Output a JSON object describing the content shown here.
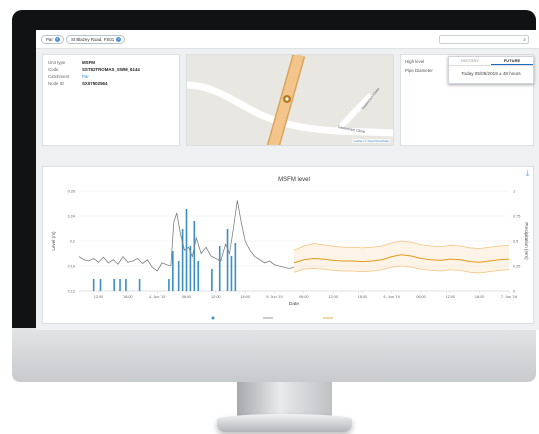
{
  "topbar": {
    "chip_1": "Par",
    "chip_2": "St Blazey Road, FS01",
    "search_placeholder": ""
  },
  "site": {
    "fields": [
      {
        "key": "Unit type",
        "value": "MSFM"
      },
      {
        "key": "Code",
        "value": "SST82TROMAS_SWM_6144"
      },
      {
        "key": "Catchment",
        "value": "Par"
      },
      {
        "key": "Node ID",
        "value": "SX07502564"
      }
    ]
  },
  "map": {
    "street_1": "Tredenham Close",
    "street_2": "Tredenham Close",
    "attribution": "Leaflet | © OpenStreetMap"
  },
  "meta": {
    "high_level_label": "High level",
    "pipe_diameter_label": "Pipe Diameter",
    "tabs": [
      "HISTORY",
      "FUTURE"
    ],
    "active_tab": "FUTURE",
    "forecast_time": "Today 05/05/2019 ± 48 hours"
  },
  "colors": {
    "observed": "#7f7f7f",
    "forecast_median": "#e39a1a",
    "forecast_band": "#f2c27a",
    "rain": "#3b8fc2",
    "link": "#3a8fd8"
  },
  "chart_data": {
    "type": "line",
    "title": "MSFM level",
    "xlabel": "Date",
    "ylabel": "Level (m)",
    "y2label": "Precipitation (mm)",
    "ylim": [
      0.12,
      0.28
    ],
    "y2lim": [
      0,
      1
    ],
    "yticks": [
      "0.28",
      "0.24",
      "0.2",
      "0.16",
      "0.12"
    ],
    "y2ticks": [
      "1",
      "0.75",
      "0.5",
      "0.25",
      "0"
    ],
    "xlim": [
      0,
      44
    ],
    "xticks": [
      {
        "x": 2,
        "label": "12:00"
      },
      {
        "x": 5,
        "label": "18:00"
      },
      {
        "x": 8,
        "label": "4. Jun '19"
      },
      {
        "x": 11,
        "label": "06:00"
      },
      {
        "x": 14,
        "label": "12:00"
      },
      {
        "x": 17,
        "label": "18:00"
      },
      {
        "x": 20,
        "label": "5. Jun '19"
      },
      {
        "x": 23,
        "label": "06:00"
      },
      {
        "x": 26,
        "label": "12:00"
      },
      {
        "x": 29,
        "label": "18:00"
      },
      {
        "x": 32,
        "label": "6. Jun '19"
      },
      {
        "x": 35,
        "label": "06:00"
      },
      {
        "x": 38,
        "label": "12:00"
      },
      {
        "x": 41,
        "label": "18:00"
      },
      {
        "x": 44,
        "label": "7. Jun '19"
      }
    ],
    "series": [
      {
        "kind": "observed",
        "x": [
          0,
          0.5,
          1,
          1.5,
          2,
          2.5,
          3,
          3.5,
          4,
          4.5,
          5,
          5.5,
          6,
          6.5,
          7,
          7.5,
          8,
          8.5,
          9,
          9.4,
          9.7,
          10,
          10.4,
          10.8,
          11.2,
          11.6,
          12,
          12.5,
          13,
          13.5,
          14,
          14.5,
          15,
          15.4,
          15.8,
          16.2,
          16.6,
          17,
          17.5,
          18,
          18.5,
          19,
          19.5,
          20,
          20.5,
          21,
          21.5,
          22
        ],
        "y": [
          0.175,
          0.17,
          0.168,
          0.172,
          0.166,
          0.174,
          0.165,
          0.17,
          0.163,
          0.175,
          0.166,
          0.168,
          0.172,
          0.164,
          0.17,
          0.158,
          0.152,
          0.165,
          0.162,
          0.16,
          0.23,
          0.245,
          0.21,
          0.185,
          0.19,
          0.175,
          0.205,
          0.18,
          0.19,
          0.176,
          0.172,
          0.168,
          0.195,
          0.18,
          0.22,
          0.265,
          0.23,
          0.2,
          0.185,
          0.175,
          0.17,
          0.165,
          0.168,
          0.162,
          0.16,
          0.158,
          0.156,
          0.158
        ]
      },
      {
        "kind": "forecast",
        "x": [
          22,
          23,
          24,
          25,
          26,
          27,
          28,
          29,
          30,
          31,
          32,
          33,
          34,
          35,
          36,
          37,
          38,
          39,
          40,
          41,
          42,
          43,
          44
        ],
        "median": [
          0.165,
          0.17,
          0.172,
          0.171,
          0.169,
          0.168,
          0.168,
          0.167,
          0.168,
          0.17,
          0.175,
          0.178,
          0.176,
          0.172,
          0.17,
          0.169,
          0.171,
          0.17,
          0.167,
          0.166,
          0.168,
          0.17,
          0.171
        ],
        "upper": [
          0.185,
          0.192,
          0.196,
          0.194,
          0.192,
          0.19,
          0.19,
          0.189,
          0.19,
          0.192,
          0.197,
          0.2,
          0.198,
          0.194,
          0.192,
          0.191,
          0.193,
          0.192,
          0.189,
          0.188,
          0.19,
          0.192,
          0.193
        ],
        "lower": [
          0.15,
          0.155,
          0.156,
          0.155,
          0.153,
          0.152,
          0.152,
          0.151,
          0.152,
          0.154,
          0.158,
          0.16,
          0.158,
          0.155,
          0.153,
          0.152,
          0.154,
          0.153,
          0.15,
          0.149,
          0.151,
          0.153,
          0.154
        ]
      }
    ],
    "precipitation": {
      "x": [
        1.5,
        2.2,
        3.6,
        4.2,
        4.8,
        6.2,
        9.2,
        9.6,
        10.2,
        10.6,
        11.0,
        11.4,
        11.8,
        12.2,
        13.6,
        14.4,
        15.2,
        15.6,
        16.0
      ],
      "values": [
        0.12,
        0.12,
        0.12,
        0.12,
        0.12,
        0.12,
        0.12,
        0.4,
        0.3,
        0.62,
        0.82,
        0.45,
        0.7,
        0.3,
        0.22,
        0.45,
        0.62,
        0.35,
        0.48
      ]
    },
    "legend_position": "bottom"
  }
}
